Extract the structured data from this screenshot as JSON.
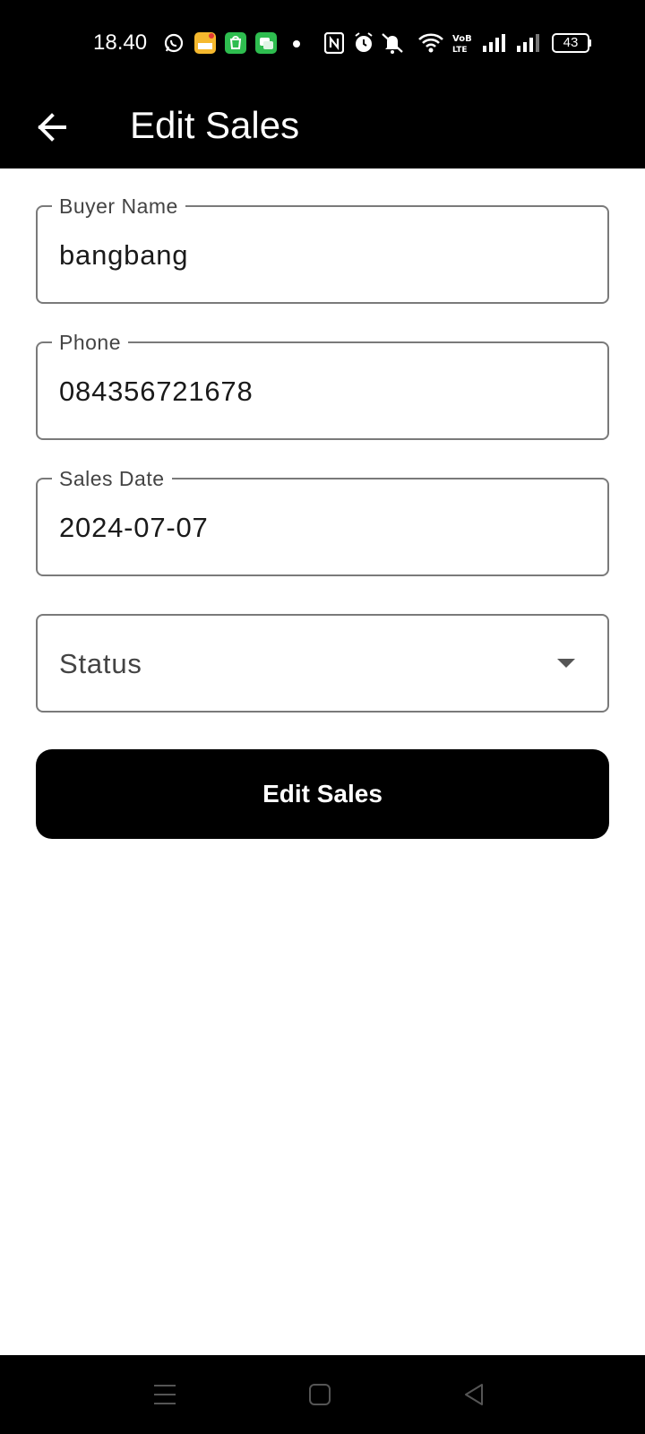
{
  "status_bar": {
    "time": "18.40",
    "battery": "43",
    "icons": [
      "whatsapp-icon",
      "app-badge-icon",
      "store-icon",
      "messages-icon",
      "dot-icon",
      "nfc-icon",
      "alarm-icon",
      "mute-icon",
      "wifi-icon",
      "volte-icon",
      "signal-icon",
      "signal-icon-2",
      "battery-icon"
    ]
  },
  "app_bar": {
    "title": "Edit Sales",
    "back_icon": "arrow-left-icon"
  },
  "form": {
    "buyer_name": {
      "label": "Buyer Name",
      "value": "bangbang"
    },
    "phone": {
      "label": "Phone",
      "value": "084356721678"
    },
    "sales_date": {
      "label": "Sales Date",
      "value": "2024-07-07"
    },
    "status": {
      "placeholder": "Status",
      "icon": "dropdown-arrow-icon"
    },
    "submit_label": "Edit Sales"
  },
  "nav_bar": {
    "items": [
      "menu-icon",
      "home-icon",
      "back-triangle-icon"
    ]
  },
  "colors": {
    "app_bar_bg": "#000000",
    "border": "#7a7a7a",
    "button_bg": "#000000",
    "button_text": "#ffffff"
  }
}
